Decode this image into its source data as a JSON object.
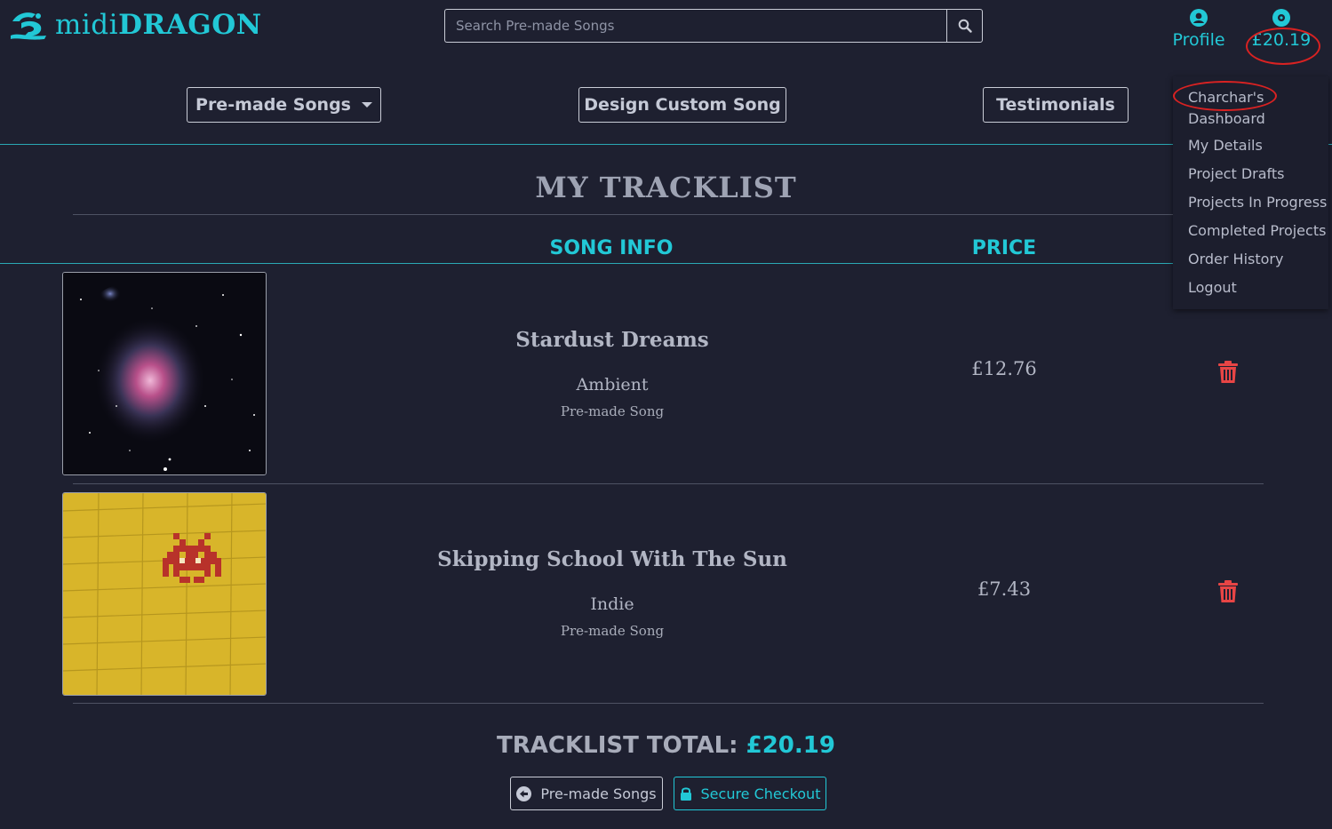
{
  "header": {
    "brand_light": "midi",
    "brand_bold": "DRAGON",
    "search_placeholder": "Search Pre-made Songs",
    "profile_label": "Profile",
    "bag_total": "£20.19"
  },
  "nav": {
    "premade": "Pre-made Songs",
    "custom": "Design Custom Song",
    "testimonials": "Testimonials"
  },
  "dropdown": {
    "dashboard": "Charchar's Dashboard",
    "details": "My Details",
    "drafts": "Project Drafts",
    "in_progress": "Projects In Progress",
    "completed": "Completed Projects",
    "history": "Order History",
    "logout": "Logout"
  },
  "main": {
    "title": "MY TRACKLIST",
    "col_info": "SONG INFO",
    "col_price": "PRICE",
    "songs": [
      {
        "title": "Stardust Dreams",
        "genre": "Ambient",
        "type": "Pre-made Song",
        "price": "£12.76",
        "art": "nebula"
      },
      {
        "title": "Skipping School With The Sun",
        "genre": "Indie",
        "type": "Pre-made Song",
        "price": "£7.43",
        "art": "space-invader-on-yellow-brick"
      }
    ],
    "total_label": "TRACKLIST TOTAL:",
    "total_value": "£20.19",
    "back_button": "Pre-made Songs",
    "checkout_button": "Secure Checkout"
  },
  "colors": {
    "accent": "#22c8d6",
    "background": "#1e2030",
    "delete": "#e84545",
    "annotation": "#d92222"
  },
  "icons": [
    "dragon-logo-icon",
    "search-icon",
    "user-circle-icon",
    "disc-icon",
    "caret-down-icon",
    "trash-icon",
    "arrow-left-circle-icon",
    "lock-icon"
  ]
}
